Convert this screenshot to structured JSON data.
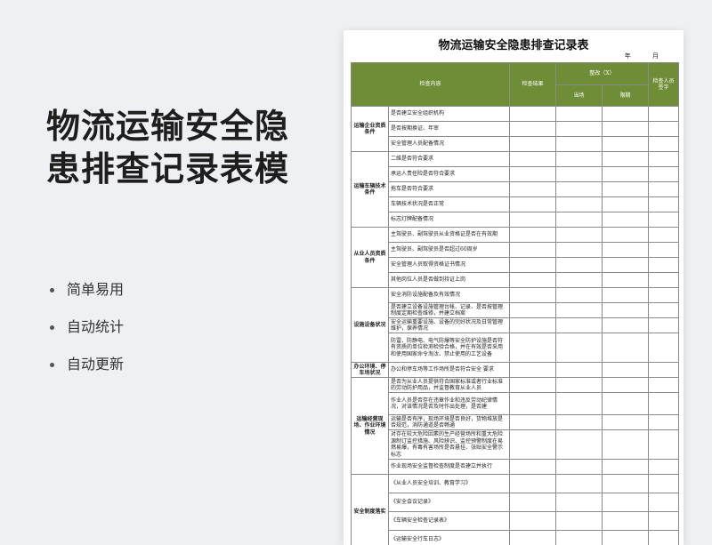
{
  "hero": {
    "title": "物流运输安全隐患排查记录表模",
    "features": [
      "简单易用",
      "自动统计",
      "自动更新"
    ]
  },
  "sheet": {
    "title": "物流运输安全隐患排查记录表",
    "date_year": "年",
    "date_month": "月",
    "header": {
      "content": "检查内容",
      "result": "检查结果",
      "rectify": "整改（X）",
      "on_site": "当场",
      "deadline": "限期",
      "inspector": "检查人员签字"
    },
    "sections": [
      {
        "category": "运输企业资质条件",
        "items": [
          "是否建立安全组织机构",
          "是否按期换证、年审",
          "安全管理人员配备情况"
        ]
      },
      {
        "category": "运输车辆技术条件",
        "items": [
          "二维是否符合要求",
          "承运人责任险是否符合要求",
          "拖车是否符合要求",
          "车辆技术状况是否正常",
          "标志灯牌配备情况"
        ]
      },
      {
        "category": "从业人员资质条件",
        "items": [
          "主驾驶员、副驾驶员从业资格证是否在有效期",
          "主驾驶员、副驾驶员是否超过60周岁",
          "安全管理人员取得资格证书情况",
          "其他岗位人员是否做到持证上岗"
        ]
      },
      {
        "category": "设施设备状况",
        "items": [
          "安全消防设施配备及有效情况",
          "是否建立设备设施管理台帐、记录、是否按管理制度定期检查维修，并建立档案",
          "安全运输重要设施、设备的完好状况及日常管理维护，保养情况",
          "防雷、防静电、电气防爆等安全防护设施是否符有资质的单位检测检验合格，并在有效是否采用和使用国家命令淘汰、禁止使用的工艺设备"
        ]
      },
      {
        "category": "办公环境、停车场状况",
        "items": [
          "办公和停车场等工作场所是否符合安全 要求"
        ]
      },
      {
        "category": "运输经营现场、作业环境情况",
        "items": [
          "是否为从业人员提供符合国家标准或者行业标准的劳动防护用品，并监督教育从业人员",
          "作业人员是否存在违章作业和违反劳动纪律情况，对该情况是否及时作出处理，是否建",
          "运输是否有序，现场环境是否良好，货物堆放是否规范，消防通道是否畅通",
          "对存在较大危险因素的生产经营场所和重大危险源制订监控措施、风险辨识、监控预警制度在易燃易爆，有毒有害场所是否悬挂、张贴安全警示标志",
          "作业现场安全监督检查制度是否建立并执行"
        ]
      },
      {
        "category": "安全制度落实",
        "items": [
          "《从业人员安全培训、教育学习》",
          "《安全会议记录》",
          "《车辆安全检查记录表》",
          "《运输安全行车日志》"
        ]
      }
    ]
  }
}
